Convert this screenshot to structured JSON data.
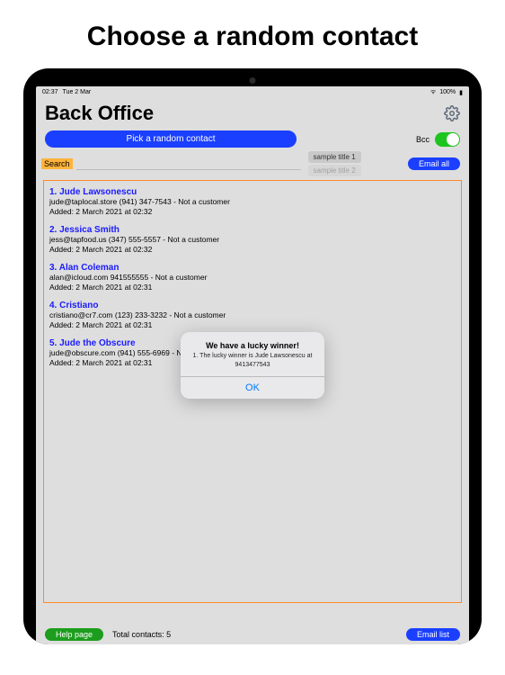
{
  "heading": "Choose a random contact",
  "statusBar": {
    "time": "02:37",
    "date": "Tue 2 Mar",
    "battery": "100%"
  },
  "app": {
    "title": "Back Office"
  },
  "controls": {
    "pickButton": "Pick a random contact",
    "bccLabel": "Bcc",
    "searchLabel": "Search",
    "searchPlaceholder": "",
    "chips": [
      "sample title 1",
      "sample title 2"
    ],
    "emailAll": "Email all"
  },
  "contacts": [
    {
      "num": "1.",
      "name": "Jude Lawsonescu",
      "email": "jude@taplocal.store",
      "phone": "(941) 347-7543",
      "status": "Not a customer",
      "added": "Added: 2 March 2021 at 02:32"
    },
    {
      "num": "2.",
      "name": "Jessica Smith",
      "email": "jess@tapfood.us",
      "phone": "(347) 555-5557",
      "status": "Not a customer",
      "added": "Added: 2 March 2021 at 02:32"
    },
    {
      "num": "3.",
      "name": "Alan Coleman",
      "email": "alan@icloud.com",
      "phone": "941555555",
      "status": "Not a customer",
      "added": "Added: 2 March 2021 at 02:31"
    },
    {
      "num": "4.",
      "name": "Cristiano",
      "email": "cristiano@cr7.com",
      "phone": "(123) 233-3232",
      "status": "Not a customer",
      "added": "Added: 2 March 2021 at 02:31"
    },
    {
      "num": "5.",
      "name": "Jude the Obscure",
      "email": "jude@obscure.com",
      "phone": "(941) 555-6969",
      "status": "N",
      "added": "Added: 2 March 2021 at 02:31"
    }
  ],
  "footer": {
    "help": "Help page",
    "total": "Total contacts: 5",
    "emailList": "Email list"
  },
  "modal": {
    "title": "We have a lucky winner!",
    "body": "1. The lucky winner is Jude Lawsonescu at 9413477543",
    "ok": "OK"
  }
}
